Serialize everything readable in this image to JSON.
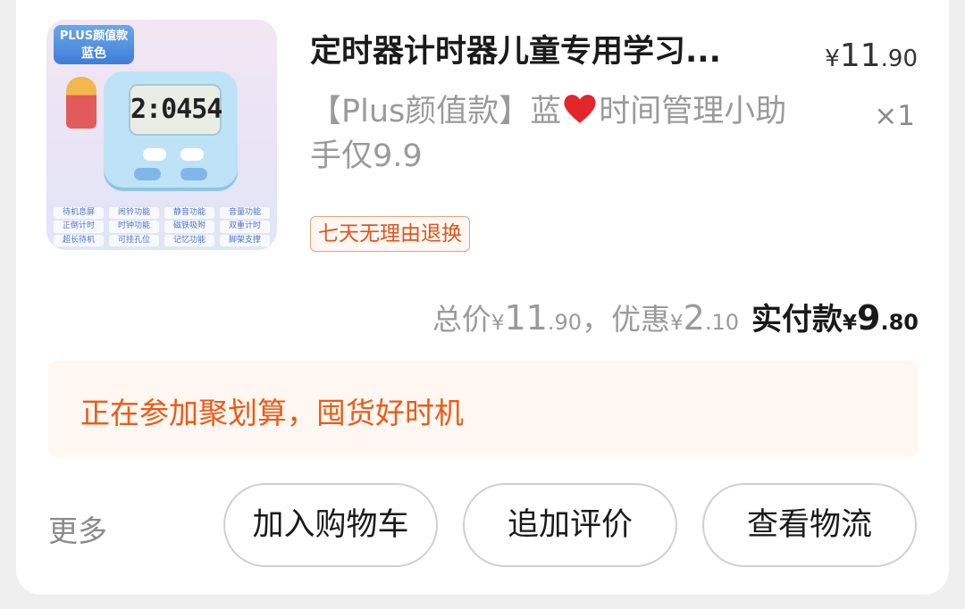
{
  "product": {
    "image": {
      "badge_line1": "PLUS颜值款",
      "badge_line2": "蓝色",
      "timer_display": "2:0454",
      "features": [
        "待机息屏",
        "闹铃功能",
        "静音功能",
        "音量功能",
        "正倒计时",
        "时钟功能",
        "磁铁吸附",
        "双重计时",
        "超长待机",
        "可挂孔位",
        "记忆功能",
        "脚架支撑"
      ]
    },
    "title": "定时器计时器儿童专用学习...",
    "price": {
      "currency": "¥",
      "integer": "11",
      "decimal": ".90"
    },
    "spec_before_heart": "【Plus颜值款】蓝",
    "spec_after_heart": "时间管理小助手仅9.9",
    "heart_icon": "heart-icon",
    "quantity": "×1",
    "return_tag": "七天无理由退换"
  },
  "summary": {
    "total_label": "总价",
    "total_currency": "¥",
    "total_int": "11",
    "total_dec": ".90",
    "separator": "，",
    "discount_label": "优惠",
    "discount_currency": "¥",
    "discount_int": "2",
    "discount_dec": ".10",
    "paid_label": "实付款",
    "paid_currency": "¥",
    "paid_int": "9",
    "paid_dec": ".80"
  },
  "promo": {
    "text": "正在参加聚划算，囤货好时机"
  },
  "actions": {
    "more": "更多",
    "add_cart": "加入购物车",
    "add_review": "追加评价",
    "view_logistics": "查看物流"
  },
  "colors": {
    "accent_orange": "#ee5a16",
    "promo_bg": "#fff7f1",
    "heart": "#e3262b"
  }
}
